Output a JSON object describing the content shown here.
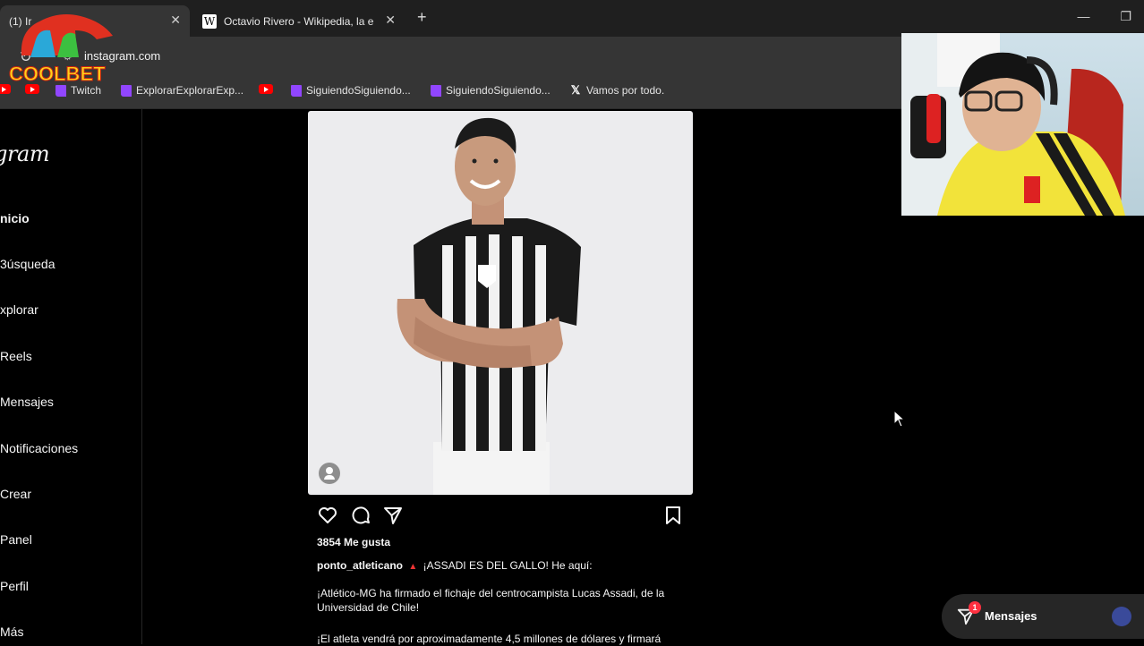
{
  "browser": {
    "tabs": [
      {
        "title": "(1) Ir",
        "active": true
      },
      {
        "title": "Octavio Rivero - Wikipedia, la e",
        "active": false
      }
    ],
    "new_tab": "+",
    "url": "instagram.com",
    "bookmarks": [
      {
        "label": "",
        "icon": "youtube-icon"
      },
      {
        "label": "",
        "icon": "youtube-icon"
      },
      {
        "label": "Twitch",
        "icon": "twitch-icon"
      },
      {
        "label": "ExplorarExplorarExp...",
        "icon": "twitch-icon"
      },
      {
        "label": "",
        "icon": "youtube-icon"
      },
      {
        "label": "SiguiendoSiguiendo...",
        "icon": "twitch-icon"
      },
      {
        "label": "SiguiendoSiguiendo...",
        "icon": "twitch-icon"
      },
      {
        "label": "Vamos por todo.",
        "icon": "x-icon"
      }
    ]
  },
  "sidebar": {
    "logo": "ıgram",
    "items": [
      {
        "label": "nicio",
        "bold": true
      },
      {
        "label": "3úsqueda"
      },
      {
        "label": "xplorar"
      },
      {
        "label": "Reels"
      },
      {
        "label": "Mensajes"
      },
      {
        "label": "Notificaciones"
      },
      {
        "label": "Crear"
      },
      {
        "label": "Panel"
      },
      {
        "label": "Perfil"
      },
      {
        "label": "Más"
      }
    ]
  },
  "post": {
    "likes": "3854 Me gusta",
    "username": "ponto_atleticano",
    "caption_first": "¡ASSADI ES DEL GALLO! He aquí:",
    "paragraph_1": "¡Atlético-MG ha firmado el fichaje del centrocampista Lucas Assadi, de la Universidad de Chile!",
    "paragraph_2": "¡El atleta vendrá por aproximadamente 4,5 millones de dólares y firmará"
  },
  "messages_pill": {
    "label": "Mensajes",
    "badge": "1"
  },
  "overlay": {
    "brand": "COOLBET"
  }
}
